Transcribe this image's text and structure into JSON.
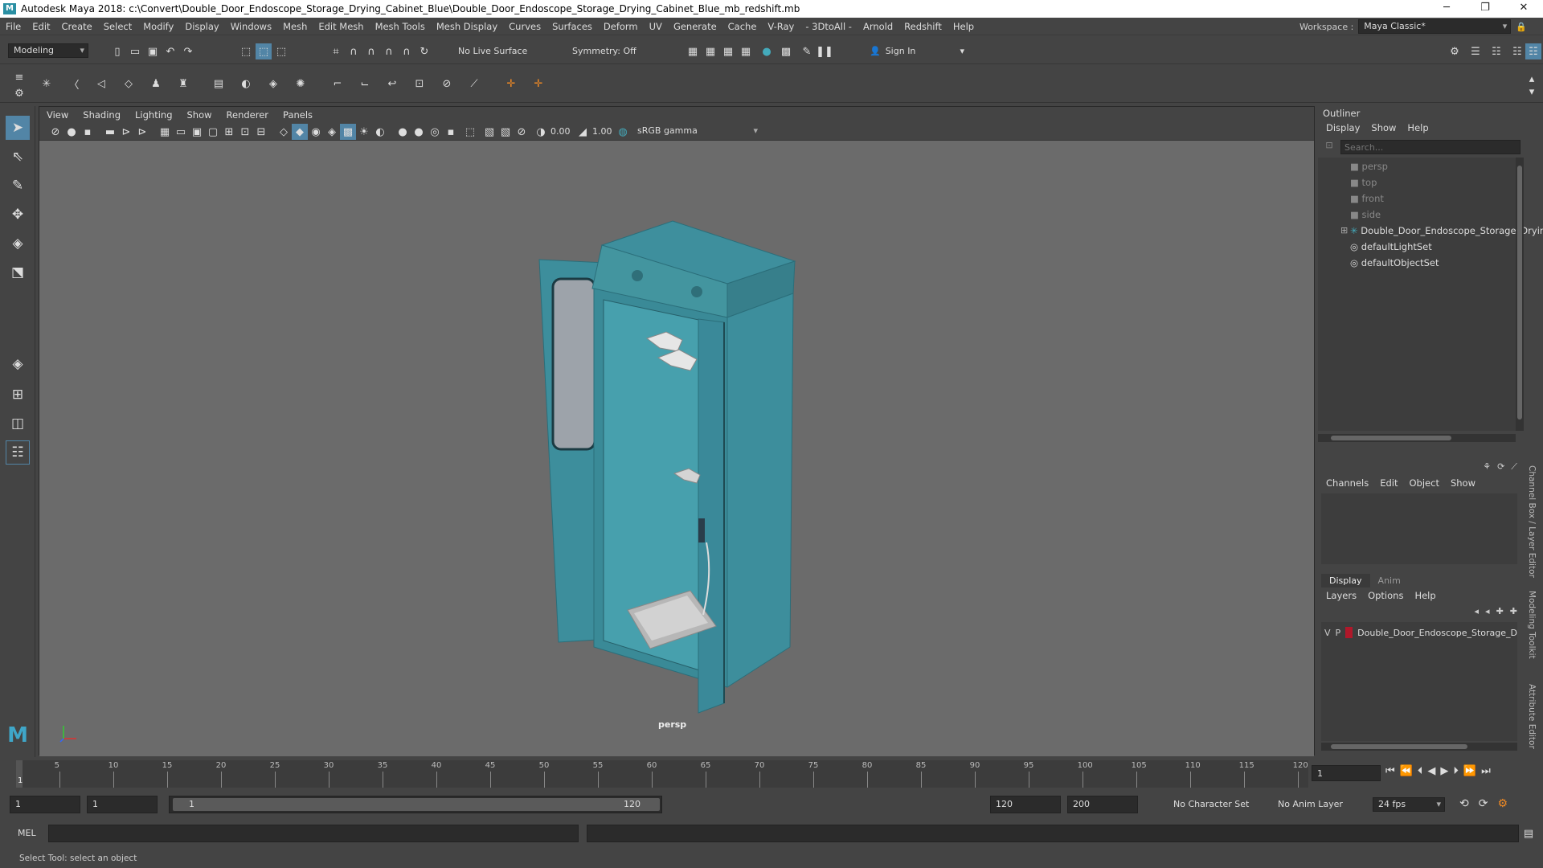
{
  "window": {
    "title": "Autodesk Maya 2018: c:\\Convert\\Double_Door_Endoscope_Storage_Drying_Cabinet_Blue\\Double_Door_Endoscope_Storage_Drying_Cabinet_Blue_mb_redshift.mb",
    "minimize": "─",
    "maximize": "❐",
    "close": "✕"
  },
  "menubar": {
    "items": [
      "File",
      "Edit",
      "Create",
      "Select",
      "Modify",
      "Display",
      "Windows",
      "Mesh",
      "Edit Mesh",
      "Mesh Tools",
      "Mesh Display",
      "Curves",
      "Surfaces",
      "Deform",
      "UV",
      "Generate",
      "Cache",
      "V-Ray",
      "- 3DtoAll -",
      "Arnold",
      "Redshift",
      "Help"
    ],
    "workspace_label": "Workspace :",
    "workspace_value": "Maya Classic*"
  },
  "statusline": {
    "mode": "Modeling",
    "live_surface": "No Live Surface",
    "symmetry": "Symmetry: Off",
    "sign_in": "Sign In"
  },
  "viewport": {
    "menus": [
      "View",
      "Shading",
      "Lighting",
      "Show",
      "Renderer",
      "Panels"
    ],
    "exposure": "0.00",
    "gamma": "1.00",
    "color_space": "sRGB gamma",
    "camera_label": "persp"
  },
  "outliner": {
    "title": "Outliner",
    "menus": [
      "Display",
      "Show",
      "Help"
    ],
    "search_placeholder": "Search...",
    "items": [
      {
        "label": "persp",
        "icon": "camera-icon",
        "dim": true
      },
      {
        "label": "top",
        "icon": "camera-icon",
        "dim": true
      },
      {
        "label": "front",
        "icon": "camera-icon",
        "dim": true
      },
      {
        "label": "side",
        "icon": "camera-icon",
        "dim": true
      },
      {
        "label": "Double_Door_Endoscope_Storage_Dryir",
        "icon": "group-icon",
        "dim": false
      },
      {
        "label": "defaultLightSet",
        "icon": "set-icon",
        "dim": false
      },
      {
        "label": "defaultObjectSet",
        "icon": "set-icon",
        "dim": false
      }
    ]
  },
  "channelbox": {
    "menus": [
      "Channels",
      "Edit",
      "Object",
      "Show"
    ]
  },
  "layereditor": {
    "tabs": [
      "Display",
      "Anim"
    ],
    "menus": [
      "Layers",
      "Options",
      "Help"
    ],
    "layer": {
      "v": "V",
      "p": "P",
      "name": "Double_Door_Endoscope_Storage_D",
      "color": "#b0182a"
    }
  },
  "sidetabs": [
    "Channel Box / Layer Editor",
    "Modeling Toolkit",
    "Attribute Editor"
  ],
  "timeline": {
    "ticks": [
      "5",
      "10",
      "15",
      "20",
      "25",
      "30",
      "35",
      "40",
      "45",
      "50",
      "55",
      "60",
      "65",
      "70",
      "75",
      "80",
      "85",
      "90",
      "95",
      "100",
      "105",
      "110",
      "115",
      "120"
    ],
    "start_marker": "1",
    "current_frame": "1"
  },
  "range": {
    "start": "1",
    "playback_start": "1",
    "slider_start": "1",
    "slider_end": "120",
    "playback_end": "120",
    "end": "200",
    "character_set": "No Character Set",
    "anim_layer": "No Anim Layer",
    "fps": "24 fps"
  },
  "command": {
    "label": "MEL"
  },
  "help": {
    "text": "Select Tool: select an object"
  },
  "colors": {
    "ui_bg": "#444444",
    "viewport_bg": "#6b6b6b",
    "cabinet": "#3d8e9c",
    "accent": "#5285a6"
  }
}
